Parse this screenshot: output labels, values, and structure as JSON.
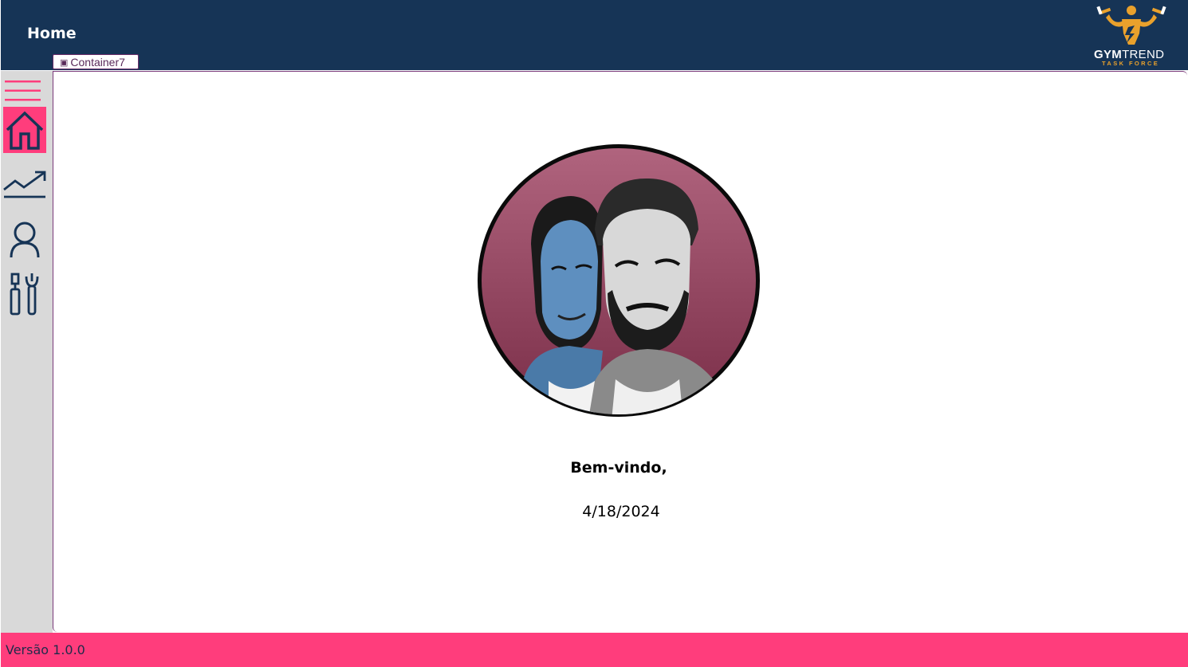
{
  "header": {
    "title": "Home",
    "container_tag": "Container7",
    "logo": {
      "name_bold": "GYM",
      "name_light": "TREND",
      "tagline": "TASK FORCE"
    }
  },
  "sidebar": {
    "items": [
      {
        "icon": "menu-icon",
        "active": false
      },
      {
        "icon": "home-icon",
        "active": true
      },
      {
        "icon": "trending-chart-icon",
        "active": false
      },
      {
        "icon": "user-icon",
        "active": false
      },
      {
        "icon": "tools-icon",
        "active": false
      }
    ]
  },
  "main": {
    "welcome_text": "Bem-vindo,",
    "date": "4/18/2024"
  },
  "footer": {
    "version": "Versão 1.0.0"
  },
  "colors": {
    "header_bg": "#163456",
    "accent_pink": "#ff3d7c",
    "sidebar_bg": "#d9d9d9",
    "icon_navy": "#163456",
    "logo_orange": "#e9a12c"
  }
}
